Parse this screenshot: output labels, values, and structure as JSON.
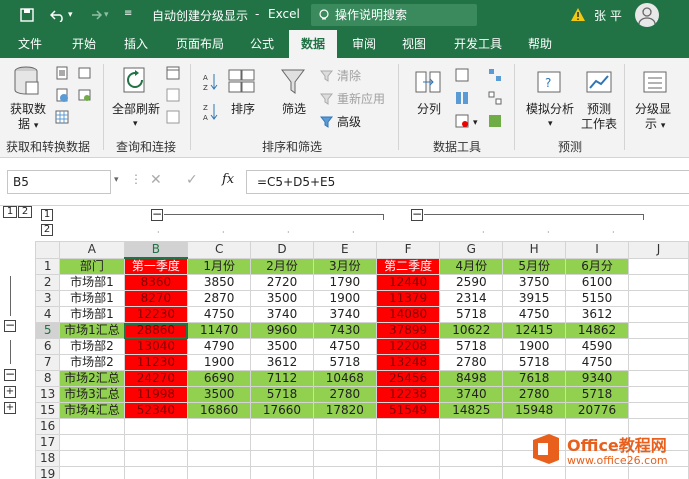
{
  "titlebar": {
    "filename": "自动创建分级显示",
    "separator": "-",
    "app": "Excel",
    "search_placeholder": "操作说明搜索",
    "user": "张 平"
  },
  "tabs": [
    "文件",
    "开始",
    "插入",
    "页面布局",
    "公式",
    "数据",
    "审阅",
    "视图",
    "开发工具",
    "帮助"
  ],
  "ribbon": {
    "get_data": "获取数",
    "get_data2": "据",
    "group_get": "获取和转换数据",
    "refresh_all": "全部刷新",
    "group_query": "查询和连接",
    "sort": "排序",
    "filter": "筛选",
    "clear": "清除",
    "reapply": "重新应用",
    "advanced": "高级",
    "group_sort": "排序和筛选",
    "split": "分列",
    "group_tools": "数据工具",
    "whatif": "模拟分析",
    "forecast": "预测",
    "forecast2": "工作表",
    "group_forecast": "预测",
    "outline": "分级显",
    "outline2": "示"
  },
  "formula_bar": {
    "name_box": "B5",
    "fx": "fx",
    "formula": "=C5+D5+E5"
  },
  "outline": {
    "level1": "1",
    "level2": "2",
    "minus": "−",
    "plus": "+"
  },
  "sheet": {
    "columns": [
      "A",
      "B",
      "C",
      "D",
      "E",
      "F",
      "G",
      "H",
      "I",
      "J"
    ],
    "rows": [
      {
        "n": "1",
        "cells": [
          "部门",
          "第一季度",
          "1月份",
          "2月份",
          "3月份",
          "第二季度",
          "4月份",
          "5月份",
          "6月分"
        ]
      },
      {
        "n": "2",
        "cells": [
          "市场部1",
          "8360",
          "3850",
          "2720",
          "1790",
          "12440",
          "2590",
          "3750",
          "6100"
        ]
      },
      {
        "n": "3",
        "cells": [
          "市场部1",
          "8270",
          "2870",
          "3500",
          "1900",
          "11379",
          "2314",
          "3915",
          "5150"
        ]
      },
      {
        "n": "4",
        "cells": [
          "市场部1",
          "12230",
          "4750",
          "3740",
          "3740",
          "14080",
          "5718",
          "4750",
          "3612"
        ]
      },
      {
        "n": "5",
        "cells": [
          "市场1汇总",
          "28860",
          "11470",
          "9960",
          "7430",
          "37899",
          "10622",
          "12415",
          "14862"
        ]
      },
      {
        "n": "6",
        "cells": [
          "市场部2",
          "13040",
          "4790",
          "3500",
          "4750",
          "12208",
          "5718",
          "1900",
          "4590"
        ]
      },
      {
        "n": "7",
        "cells": [
          "市场部2",
          "11230",
          "1900",
          "3612",
          "5718",
          "13248",
          "2780",
          "5718",
          "4750"
        ]
      },
      {
        "n": "8",
        "cells": [
          "市场2汇总",
          "24270",
          "6690",
          "7112",
          "10468",
          "25456",
          "8498",
          "7618",
          "9340"
        ]
      },
      {
        "n": "13",
        "cells": [
          "市场3汇总",
          "11998",
          "3500",
          "5718",
          "2780",
          "12238",
          "3740",
          "2780",
          "5718"
        ]
      },
      {
        "n": "15",
        "cells": [
          "市场4汇总",
          "52340",
          "16860",
          "17660",
          "17820",
          "51549",
          "14825",
          "15948",
          "20776"
        ]
      },
      {
        "n": "16",
        "cells": [
          "",
          "",
          "",
          "",
          "",
          "",
          "",
          "",
          ""
        ]
      },
      {
        "n": "17",
        "cells": [
          "",
          "",
          "",
          "",
          "",
          "",
          "",
          "",
          ""
        ]
      },
      {
        "n": "18",
        "cells": [
          "",
          "",
          "",
          "",
          "",
          "",
          "",
          "",
          ""
        ]
      },
      {
        "n": "19",
        "cells": [
          "",
          "",
          "",
          "",
          "",
          "",
          "",
          "",
          ""
        ]
      }
    ]
  },
  "watermark": {
    "brand": "Office教程网",
    "url": "www.office26.com"
  },
  "colors": {
    "excel_green": "#217346",
    "summary_green": "#92d050",
    "quarter_red": "#ff0000"
  }
}
